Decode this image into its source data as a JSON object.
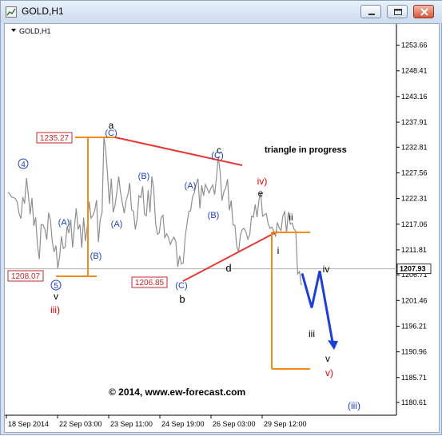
{
  "window": {
    "title": "GOLD,H1"
  },
  "chart_data": {
    "type": "line",
    "title": "GOLD,H1",
    "y_ticks": [
      "1253.66",
      "1248.41",
      "1243.16",
      "1237.91",
      "1232.81",
      "1227.56",
      "1222.31",
      "1217.06",
      "1211.81",
      "1206.71",
      "1201.46",
      "1196.21",
      "1190.96",
      "1185.71",
      "1180.61"
    ],
    "x_ticks": [
      "18 Sep 2014",
      "22 Sep 03:00",
      "23 Sep 11:00",
      "24 Sep 19:00",
      "26 Sep 03:00",
      "29 Sep 12:00"
    ],
    "current_price": "1207.93",
    "price_labels": {
      "high": "1235.27",
      "low_left": "1208.07",
      "low_mid": "1206.85"
    },
    "annotation_text": "triangle in progress",
    "copyright": "© 2014, www.ew-forecast.com",
    "wave_labels": {
      "circ4": "4",
      "circ5": "5",
      "v_small": "v",
      "iii_red": "iii)",
      "A1": "(A)",
      "B1": "(B)",
      "a": "a",
      "C1": "(C)",
      "A2": "(A)",
      "B2": "(B)",
      "A3": "(A)",
      "B3": "(B)",
      "b": "b",
      "C2": "(C)",
      "c": "c",
      "C3": "(C)",
      "d": "d",
      "iv_red": "iv)",
      "e": "e",
      "i": "i",
      "ii": "ii",
      "iii": "iii",
      "iv": "iv",
      "v2": "v",
      "v_red": "v)",
      "iii_blue": "(iii)"
    },
    "series": [
      {
        "values": [
          1223.6,
          1223.2,
          1222.6,
          1222.5,
          1222.3,
          1221.6,
          1219.3,
          1218.2,
          1222.6,
          1221.3,
          1226.5,
          1223.1,
          1219.1,
          1222.4,
          1216.7,
          1218.5,
          1212.7,
          1209.9,
          1217.0,
          1216.9,
          1216.0,
          1213.9,
          1219.4,
          1217.9,
          1213.5,
          1211.4,
          1212.7,
          1208.0,
          1210.4,
          1214.6,
          1212.1,
          1212.4,
          1216.6,
          1215.2,
          1218.0,
          1212.3,
          1216.5,
          1220.3,
          1216.0,
          1217.0,
          1212.2,
          1218.4,
          1213.6,
          1216.7,
          1221.7,
          1218.3,
          1218.8,
          1219.9,
          1222.0,
          1213.4,
          1218.0,
          1219.5,
          1235.0,
          1232.1,
          1227.1,
          1221.2,
          1226.4,
          1219.5,
          1220.9,
          1223.6,
          1226.8,
          1223.6,
          1221.4,
          1219.3,
          1221.8,
          1223.1,
          1225.5,
          1220.0,
          1219.7,
          1216.0,
          1218.2,
          1222.9,
          1222.5,
          1224.8,
          1219.1,
          1218.8,
          1224.0,
          1219.5,
          1226.8,
          1224.3,
          1217.2,
          1215.0,
          1215.3,
          1218.4,
          1218.9,
          1214.3,
          1215.1,
          1214.3,
          1212.9,
          1213.8,
          1214.4,
          1213.5,
          1208.3,
          1210.6,
          1208.9,
          1209.2,
          1214.2,
          1217.0,
          1219.7,
          1219.8,
          1222.6,
          1223.5,
          1225.2,
          1226.4,
          1220.3,
          1225.0,
          1222.9,
          1225.2,
          1224.3,
          1223.4,
          1224.4,
          1225.1,
          1223.1,
          1226.5,
          1230.9,
          1227.8,
          1221.9,
          1223.7,
          1224.5,
          1226.3,
          1219.9,
          1221.9,
          1216.9,
          1216.8,
          1212.5,
          1211.4,
          1214.8,
          1216.0,
          1216.2,
          1215.4,
          1214.0,
          1214.9,
          1218.7,
          1218.5,
          1221.1,
          1218.5,
          1221.9,
          1223.5,
          1218.7,
          1219.0,
          1219.2,
          1217.2,
          1216.2,
          1216.5,
          1215.7,
          1214.5,
          1217.4,
          1216.3,
          1215.8,
          1218.8,
          1219.6,
          1215.3,
          1219.6,
          1217.1,
          1217.3,
          1216.1,
          1215.6,
          1206.9,
          1207.4,
          1204.6
        ]
      }
    ],
    "forecast_path": [
      1207.0,
      1200.0,
      1207.5,
      1193.0
    ],
    "ylim": [
      1178.0,
      1258.0
    ],
    "grid": false
  }
}
